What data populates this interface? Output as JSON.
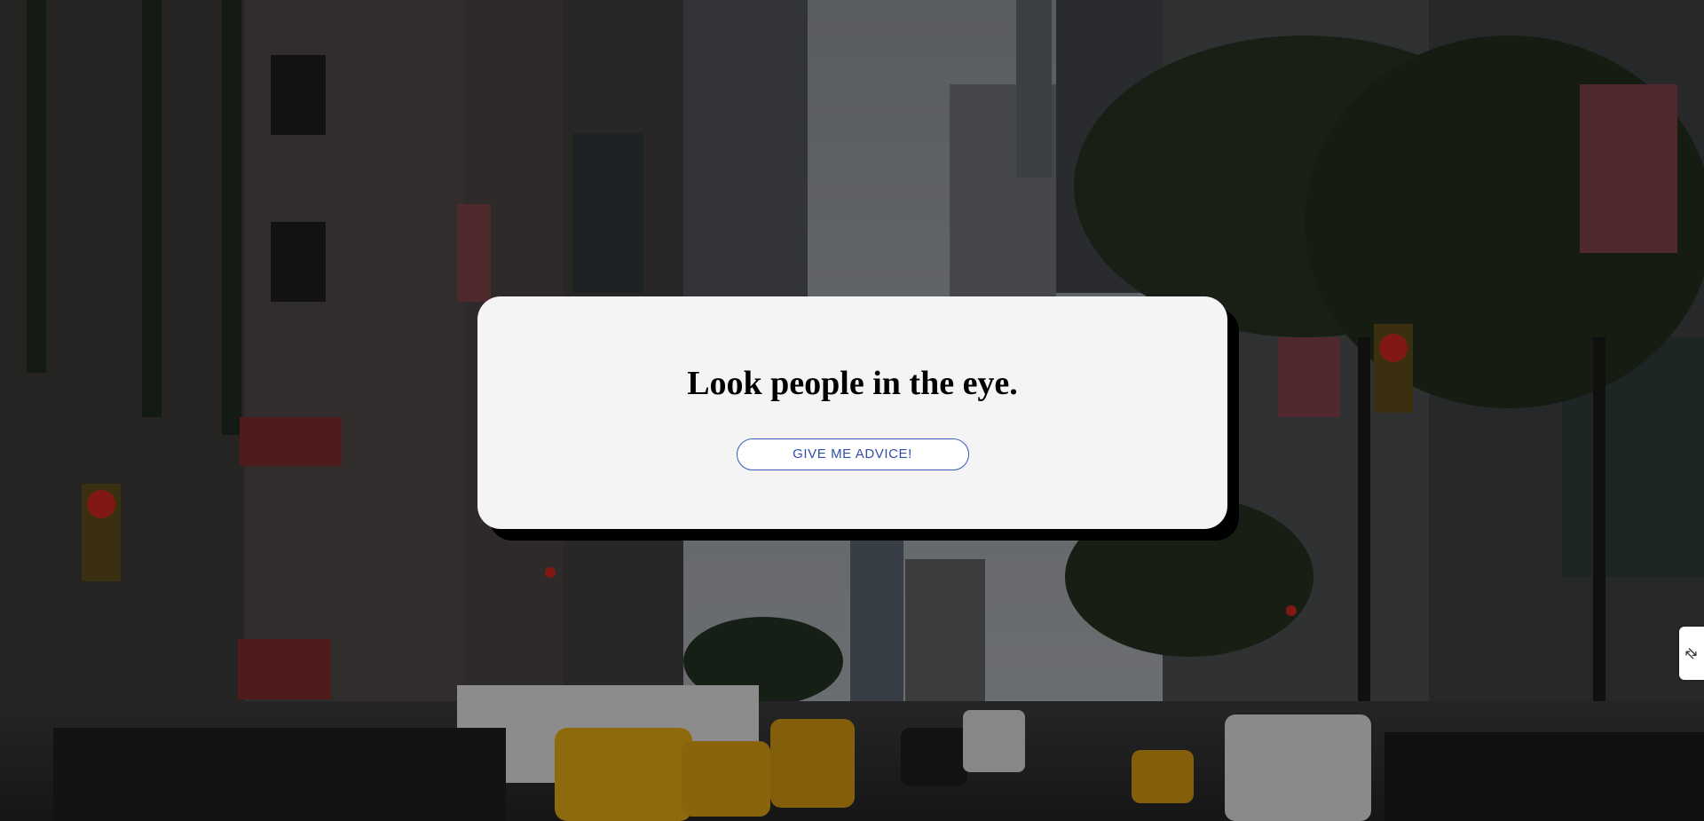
{
  "background": {
    "description_icon": "city-street-photo",
    "sky_color": "#9ea3a8",
    "building_color": "#3c3a38",
    "street_color": "#2b2b2c",
    "taxi_color": "#d9a514"
  },
  "card": {
    "advice_text": "Look people in the eye.",
    "button_label": "GIVE ME ADVICE!",
    "button_accent": "#3a5ab8",
    "background": "#f4f4f4"
  },
  "side_tab": {
    "icon": "resize-handle-icon",
    "glyph": "⇅"
  }
}
